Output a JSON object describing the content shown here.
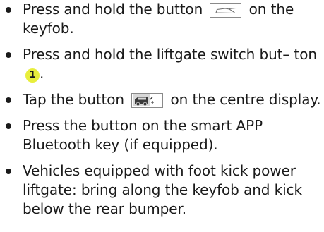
{
  "list": {
    "items": [
      {
        "before": "Press and hold the button",
        "icon": "car-trunk-icon",
        "after": "on the keyfob."
      },
      {
        "before": "Press and hold the liftgate switch but– ton",
        "callout": "1",
        "after": "."
      },
      {
        "before": "Tap the button",
        "icon": "car-tailgate-open-icon",
        "after": "on the centre display."
      },
      {
        "text": "Press the button on the smart APP Bluetooth key (if equipped)."
      },
      {
        "text": "Vehicles equipped with foot kick power liftgate: bring along the keyfob and kick below the rear bumper."
      }
    ]
  }
}
